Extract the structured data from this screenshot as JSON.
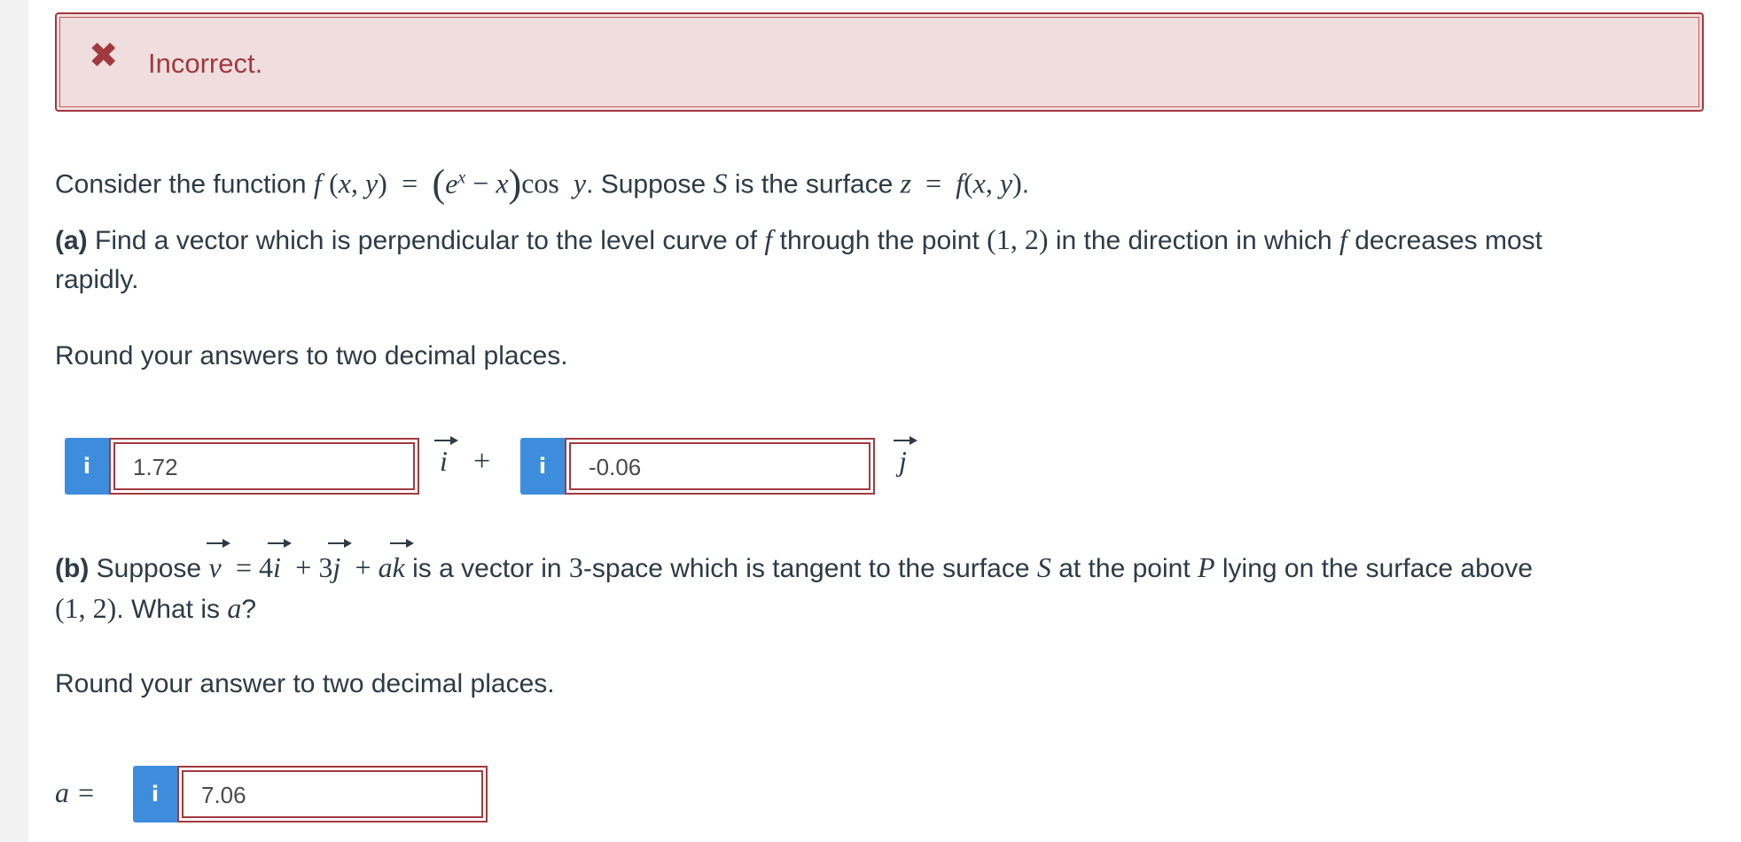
{
  "banner": {
    "icon": "close-icon",
    "text": "Incorrect."
  },
  "intro": {
    "prefix": "Consider the function",
    "mid": ". Suppose",
    "mid2": "is the surface",
    "end": "."
  },
  "part_a": {
    "label": "(a)",
    "text1": "Find a vector which is perpendicular to the level curve of",
    "text2": "through the point",
    "point": "(1, 2)",
    "text3": "in the direction in which",
    "text4": "decreases most",
    "text5": "rapidly.",
    "round_note": "Round your answers to two decimal places.",
    "answer_i": "1.72",
    "answer_j": "-0.06",
    "plus": "+"
  },
  "part_b": {
    "label": "(b)",
    "text1": "Suppose",
    "text2": "is a vector in",
    "num3": "3",
    "text3": "-space which is tangent to the surface",
    "text4": "at the point",
    "text5": "lying on the surface above",
    "point": "(1, 2)",
    "text6": ". What is",
    "text7": "?",
    "round_note": "Round your answer to two decimal places.",
    "a_label": "a =",
    "answer_a": "7.06"
  },
  "colors": {
    "error": "#a2393f",
    "error_bg": "#f0dede",
    "info_button": "#3e8ddd",
    "text": "#2d3b45"
  },
  "icons": {
    "info": "info-icon"
  }
}
